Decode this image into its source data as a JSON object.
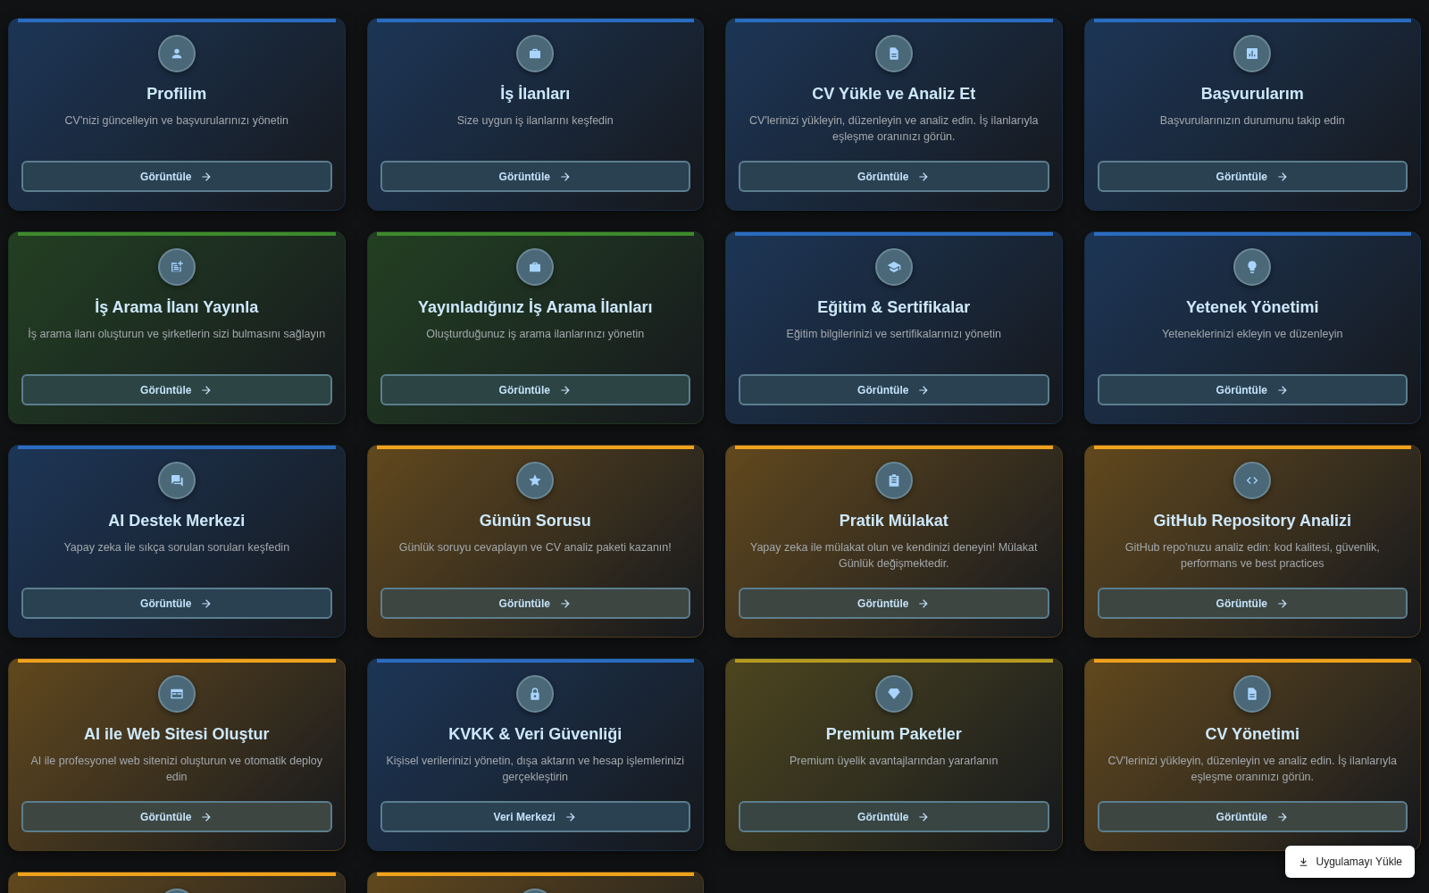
{
  "cards": [
    {
      "color": "#2a6cc0",
      "kind": "person",
      "title": "Profilim",
      "description": "CV'nizi güncelleyin ve başvurularınızı yönetin",
      "button": "Görüntüle"
    },
    {
      "color": "#2a6cc0",
      "kind": "briefcase",
      "title": "İş İlanları",
      "description": "Size uygun iş ilanlarını keşfedin",
      "button": "Görüntüle"
    },
    {
      "color": "#2a6cc0",
      "kind": "document",
      "title": "CV Yükle ve Analiz Et",
      "description": "CV'lerinizi yükleyin, düzenleyin ve analiz edin. İş ilanlarıyla eşleşme oranınızı görün.",
      "button": "Görüntüle"
    },
    {
      "color": "#2a6cc0",
      "kind": "chart",
      "title": "Başvurularım",
      "description": "Başvurularınızın durumunu takip edin",
      "button": "Görüntüle"
    },
    {
      "color": "#3d8a2c",
      "kind": "post",
      "title": "İş Arama İlanı Yayınla",
      "description": "İş arama ilanı oluşturun ve şirketlerin sizi bulmasını sağlayın",
      "button": "Görüntüle"
    },
    {
      "color": "#3d8a2c",
      "kind": "briefcase",
      "title": "Yayınladığınız İş Arama İlanları",
      "description": "Oluşturduğunuz iş arama ilanlarınızı yönetin",
      "button": "Görüntüle"
    },
    {
      "color": "#2a6cc0",
      "kind": "cap",
      "title": "Eğitim & Sertifikalar",
      "description": "Eğitim bilgilerinizi ve sertifikalarınızı yönetin",
      "button": "Görüntüle"
    },
    {
      "color": "#2a6cc0",
      "kind": "bulb",
      "title": "Yetenek Yönetimi",
      "description": "Yeteneklerinizi ekleyin ve düzenleyin",
      "button": "Görüntüle"
    },
    {
      "color": "#2a6cc0",
      "kind": "chat",
      "title": "AI Destek Merkezi",
      "description": "Yapay zeka ile sıkça sorulan soruları keşfedin",
      "button": "Görüntüle"
    },
    {
      "color": "#f0a21c",
      "kind": "star",
      "title": "Günün Sorusu",
      "description": "Günlük soruyu cevaplayın ve CV analiz paketi kazanın!",
      "button": "Görüntüle"
    },
    {
      "color": "#f0a21c",
      "kind": "clipboard",
      "title": "Pratik Mülakat",
      "description": "Yapay zeka ile mülakat olun ve kendinizi deneyin! Mülakat Günlük değişmektedir.",
      "button": "Görüntüle"
    },
    {
      "color": "#f0a21c",
      "kind": "code",
      "title": "GitHub Repository Analizi",
      "description": "GitHub repo'nuzu analiz edin: kod kalitesi, güvenlik, performans ve best practices",
      "button": "Görüntüle"
    },
    {
      "color": "#f0a21c",
      "kind": "web",
      "title": "AI ile Web Sitesi Oluştur",
      "description": "AI ile profesyonel web sitenizi oluşturun ve otomatik deploy edin",
      "button": "Görüntüle"
    },
    {
      "color": "#2a6cc0",
      "kind": "lock",
      "title": "KVKK & Veri Güvenliği",
      "description": "Kişisel verilerinizi yönetin, dışa aktarın ve hesap işlemlerinizi gerçekleştirin",
      "button": "Veri Merkezi"
    },
    {
      "color": "#b59a20",
      "kind": "diamond",
      "title": "Premium Paketler",
      "description": "Premium üyelik avantajlarından yararlanın",
      "button": "Görüntüle"
    },
    {
      "color": "#f0a21c",
      "kind": "document",
      "title": "CV Yönetimi",
      "description": "CV'lerinizi yükleyin, düzenleyin ve analiz edin. İş ilanlarıyla eşleşme oranınızı görün.",
      "button": "Görüntüle"
    },
    {
      "color": "#f0a21c"
    },
    {
      "color": "#f0a21c"
    }
  ],
  "install_button": {
    "label": "Uygulamayı Yükle"
  }
}
